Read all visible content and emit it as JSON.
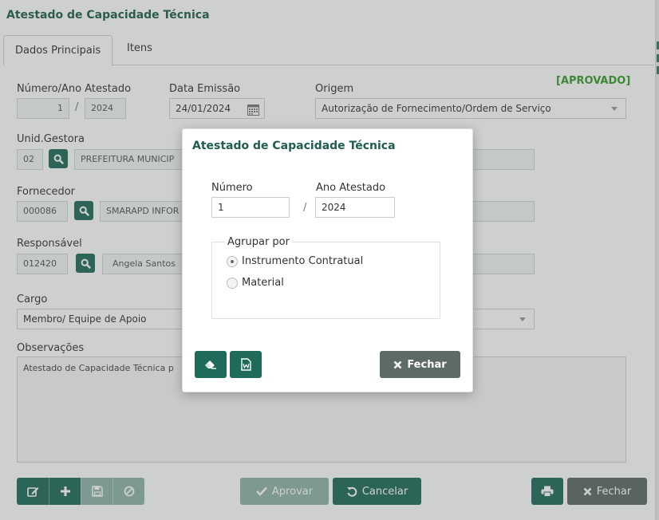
{
  "window": {
    "title": "Atestado de Capacidade Técnica"
  },
  "tabs": [
    {
      "label": "Dados Principais"
    },
    {
      "label": "Itens"
    }
  ],
  "status": "[APROVADO]",
  "form": {
    "numero_ano": {
      "label": "Número/Ano Atestado",
      "numero": "1",
      "ano": "2024"
    },
    "data_emissao": {
      "label": "Data Emissão",
      "value": "24/01/2024"
    },
    "origem": {
      "label": "Origem",
      "value": "Autorização de Fornecimento/Ordem de Serviço"
    },
    "unid_gestora": {
      "label": "Unid.Gestora",
      "code": "02",
      "name": "PREFEITURA MUNICIP"
    },
    "fornecedor": {
      "label": "Fornecedor",
      "code": "000086",
      "name": "SMARAPD INFOR"
    },
    "responsavel": {
      "label": "Responsável",
      "code": "012420",
      "name": "Angela Santos"
    },
    "cargo": {
      "label": "Cargo",
      "value": "Membro/ Equipe de Apoio"
    },
    "observacoes": {
      "label": "Observações",
      "value": "Atestado de Capacidade Técnica p"
    }
  },
  "toolbar": {
    "aprovar_label": "Aprovar",
    "cancelar_label": "Cancelar",
    "fechar_label": "Fechar"
  },
  "modal": {
    "title": "Atestado de Capacidade Técnica",
    "numero_label": "Número",
    "numero_value": "1",
    "ano_label": "Ano Atestado",
    "ano_value": "2024",
    "slash": "/",
    "agrupar": {
      "legend": "Agrupar por",
      "options": [
        {
          "label": "Instrumento Contratual",
          "selected": true
        },
        {
          "label": "Material",
          "selected": false
        }
      ]
    },
    "fechar_label": "Fechar"
  },
  "icons": {
    "search": "magnifier-icon",
    "calendar": "calendar-icon",
    "edit": "pencil-square-icon",
    "add": "plus-icon",
    "save": "floppy-icon",
    "block": "ban-icon",
    "check": "check-icon",
    "undo": "undo-icon",
    "print": "printer-icon",
    "close": "x-icon",
    "eraser": "eraser-icon",
    "word": "word-file-icon"
  },
  "colors": {
    "primary": "#1f6b5a",
    "title": "#1f5e4f",
    "approved": "#3a9a2e",
    "gray_button": "#5d6a66"
  }
}
